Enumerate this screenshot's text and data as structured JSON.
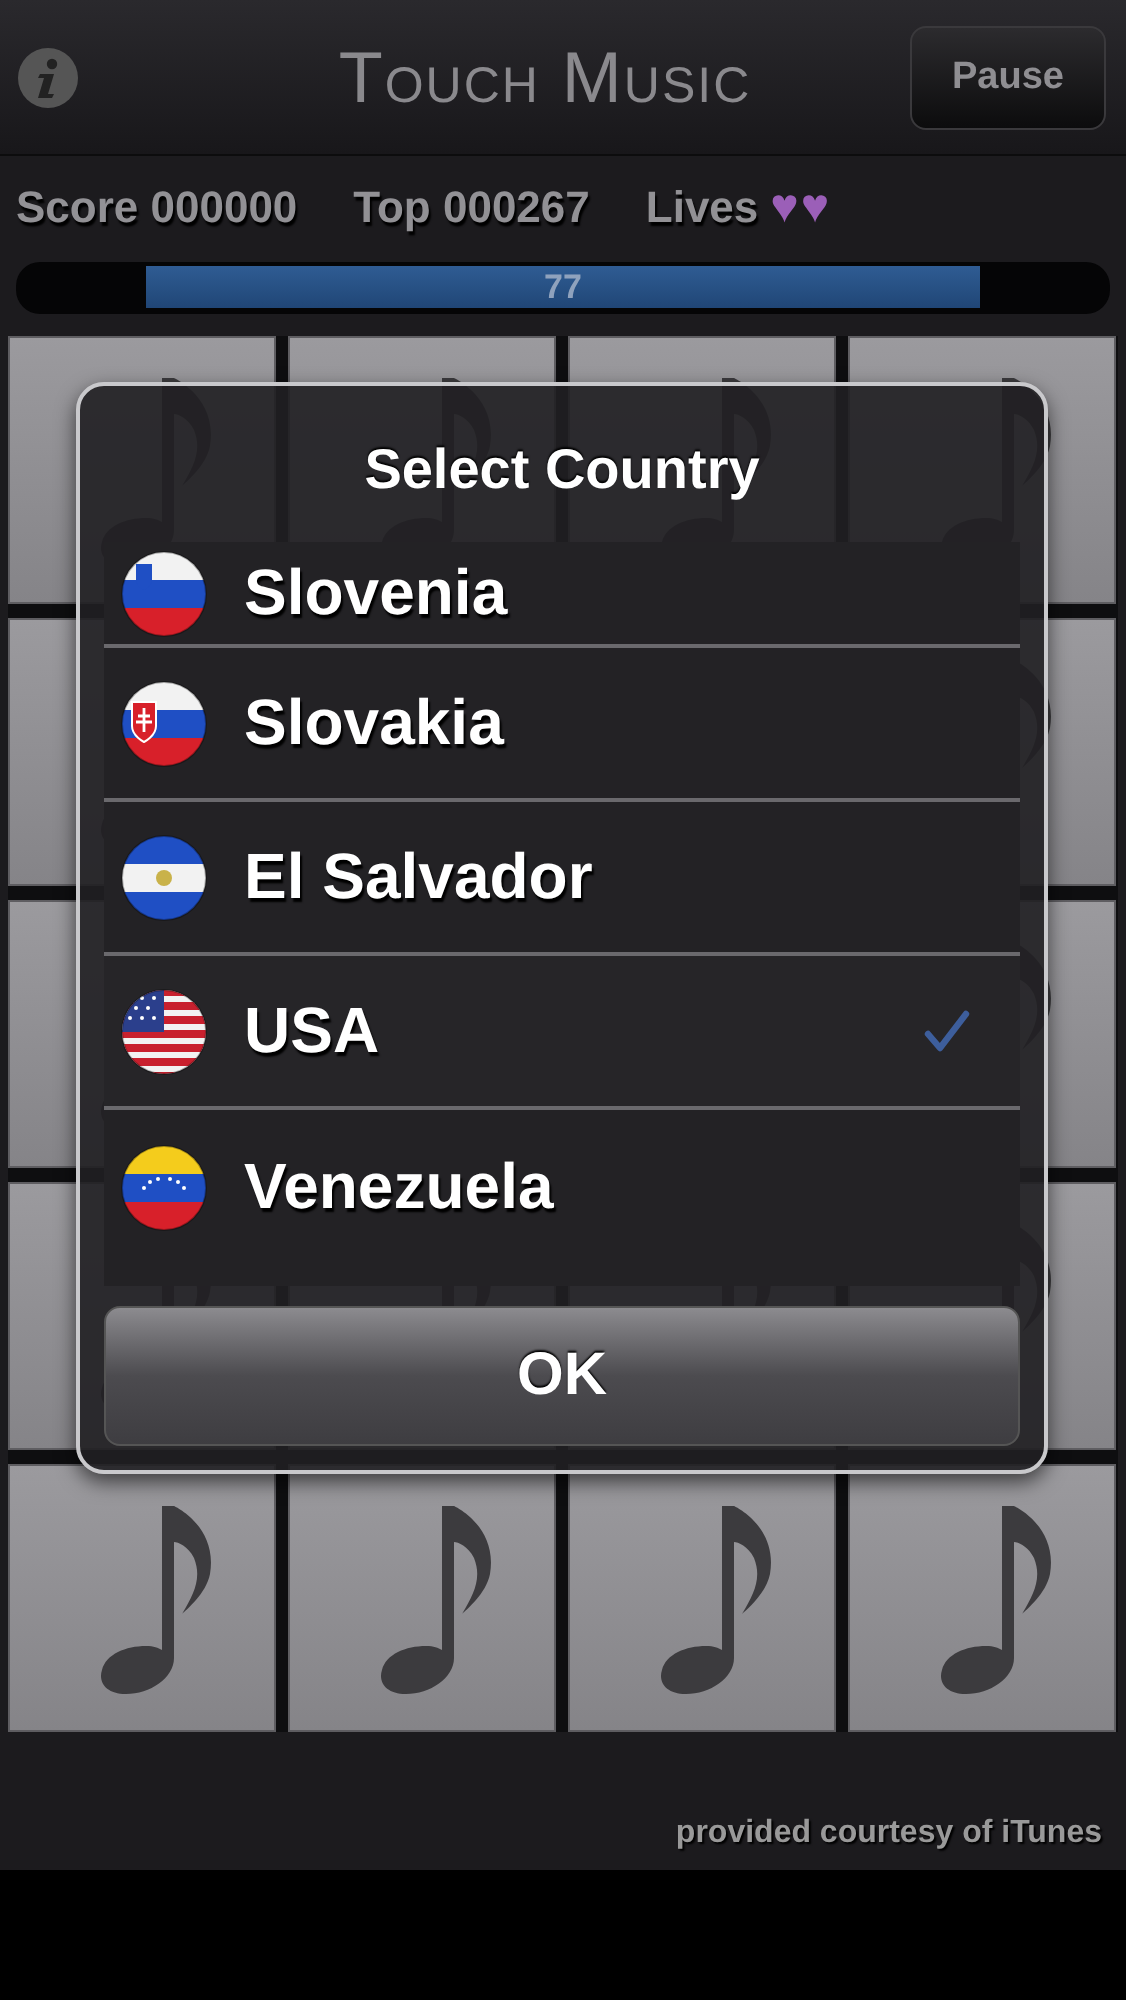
{
  "header": {
    "title": "Touch Music",
    "pause_button": "Pause"
  },
  "stats": {
    "score": "Score 000000",
    "top": "Top 000267",
    "lives_label": "Lives",
    "lives_hearts": "♥♥"
  },
  "timer": {
    "reading": "77"
  },
  "dialog": {
    "title": "Select Country",
    "countries": [
      {
        "name": "Slovenia",
        "selected": false
      },
      {
        "name": "Slovakia",
        "selected": false
      },
      {
        "name": "El Salvador",
        "selected": false
      },
      {
        "name": "USA",
        "selected": true
      },
      {
        "name": "Venezuela",
        "selected": false
      }
    ],
    "ok_button": "OK"
  },
  "footer": {
    "credit": "provided courtesy of iTunes"
  }
}
